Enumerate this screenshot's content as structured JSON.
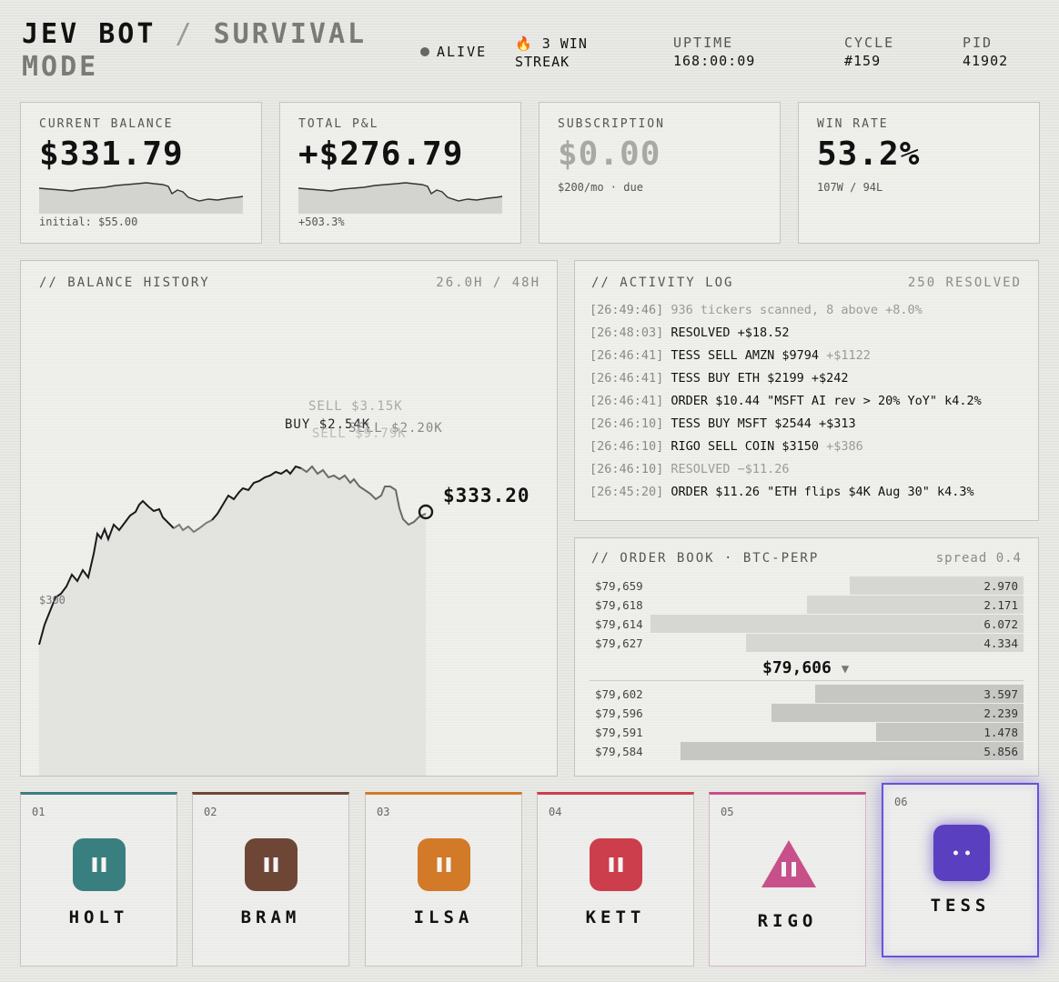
{
  "header": {
    "title": "JEV BOT",
    "slash": "/",
    "subtitle_1": "SURVIVAL",
    "subtitle_2": "MODE",
    "status": "ALIVE",
    "streak_icon": "fire-icon",
    "streak_1": "3 WIN",
    "streak_2": "STREAK",
    "uptime_label": "UPTIME",
    "uptime_value": "168:00:09",
    "cycle_label": "CYCLE",
    "cycle_value": "#159",
    "pid_label": "PID",
    "pid_value": "41902"
  },
  "stats": {
    "balance": {
      "label": "CURRENT BALANCE",
      "value": "$331.79",
      "sub": "initial: $55.00"
    },
    "pnl": {
      "label": "TOTAL P&L",
      "value": "+$276.79",
      "sub": "+503.3%"
    },
    "subscription": {
      "label": "SUBSCRIPTION",
      "value": "$0.00",
      "sub": "$200/mo · due"
    },
    "winrate": {
      "label": "WIN RATE",
      "value": "53.2%",
      "sub": "107W / 94L"
    }
  },
  "balance_history": {
    "title": "// BALANCE HISTORY",
    "range": "26.0H / 48H",
    "last_value": "$333.20",
    "axis_label": "$300",
    "annotations": [
      "SELL $3.15K",
      "BUY $2.54K",
      "SELL $2.20K",
      "SELL $9.79K"
    ]
  },
  "activity_log": {
    "title": "// ACTIVITY LOG",
    "count": "250 RESOLVED",
    "rows": [
      {
        "ts": "[26:49:46]",
        "text": "936 tickers scanned, 8 above +8.0%",
        "dim": true
      },
      {
        "ts": "[26:48:03]",
        "text": "RESOLVED +$18.52",
        "dim": false
      },
      {
        "ts": "[26:46:41]",
        "text": "TESS SELL AMZN $9794",
        "extra": "+$1122",
        "dim": false
      },
      {
        "ts": "[26:46:41]",
        "text": "TESS BUY ETH $2199 +$242",
        "dim": false
      },
      {
        "ts": "[26:46:41]",
        "text": "ORDER $10.44 \"MSFT AI rev > 20% YoY\" k4.2%",
        "dim": false
      },
      {
        "ts": "[26:46:10]",
        "text": "TESS BUY MSFT $2544 +$313",
        "dim": false
      },
      {
        "ts": "[26:46:10]",
        "text": "RIGO SELL COIN $3150",
        "extra": "+$386",
        "dim": false
      },
      {
        "ts": "[26:46:10]",
        "text": "RESOLVED −$11.26",
        "dim": true
      },
      {
        "ts": "[26:45:20]",
        "text": "ORDER $11.26 \"ETH flips $4K Aug 30\" k4.3%",
        "dim": false
      }
    ]
  },
  "order_book": {
    "title": "// ORDER BOOK · BTC-PERP",
    "spread": "spread 0.4",
    "mid_price": "$79,606",
    "mid_arrow": "▼",
    "asks": [
      {
        "price": "$79,659",
        "size": "2.970",
        "depth": 0.4
      },
      {
        "price": "$79,618",
        "size": "2.171",
        "depth": 0.5
      },
      {
        "price": "$79,614",
        "size": "6.072",
        "depth": 0.86
      },
      {
        "price": "$79,627",
        "size": "4.334",
        "depth": 0.64
      }
    ],
    "bids": [
      {
        "price": "$79,602",
        "size": "3.597",
        "depth": 0.48
      },
      {
        "price": "$79,596",
        "size": "2.239",
        "depth": 0.58
      },
      {
        "price": "$79,591",
        "size": "1.478",
        "depth": 0.34
      },
      {
        "price": "$79,584",
        "size": "5.856",
        "depth": 0.79
      }
    ]
  },
  "agents": [
    {
      "num": "01",
      "name": "HOLT",
      "color": "#3a7f7f",
      "shape": "square",
      "state": "pause-icon"
    },
    {
      "num": "02",
      "name": "BRAM",
      "color": "#6e4636",
      "shape": "square",
      "state": "pause-icon"
    },
    {
      "num": "03",
      "name": "ILSA",
      "color": "#d27a28",
      "shape": "square",
      "state": "pause-icon"
    },
    {
      "num": "04",
      "name": "KETT",
      "color": "#cc3e4c",
      "shape": "square",
      "state": "pause-icon"
    },
    {
      "num": "05",
      "name": "RIGO",
      "color": "#c8508a",
      "shape": "triangle",
      "state": "pause-icon"
    },
    {
      "num": "06",
      "name": "TESS",
      "color": "#5a3fc0",
      "shape": "square",
      "state": "face-icon",
      "active": true
    }
  ]
}
